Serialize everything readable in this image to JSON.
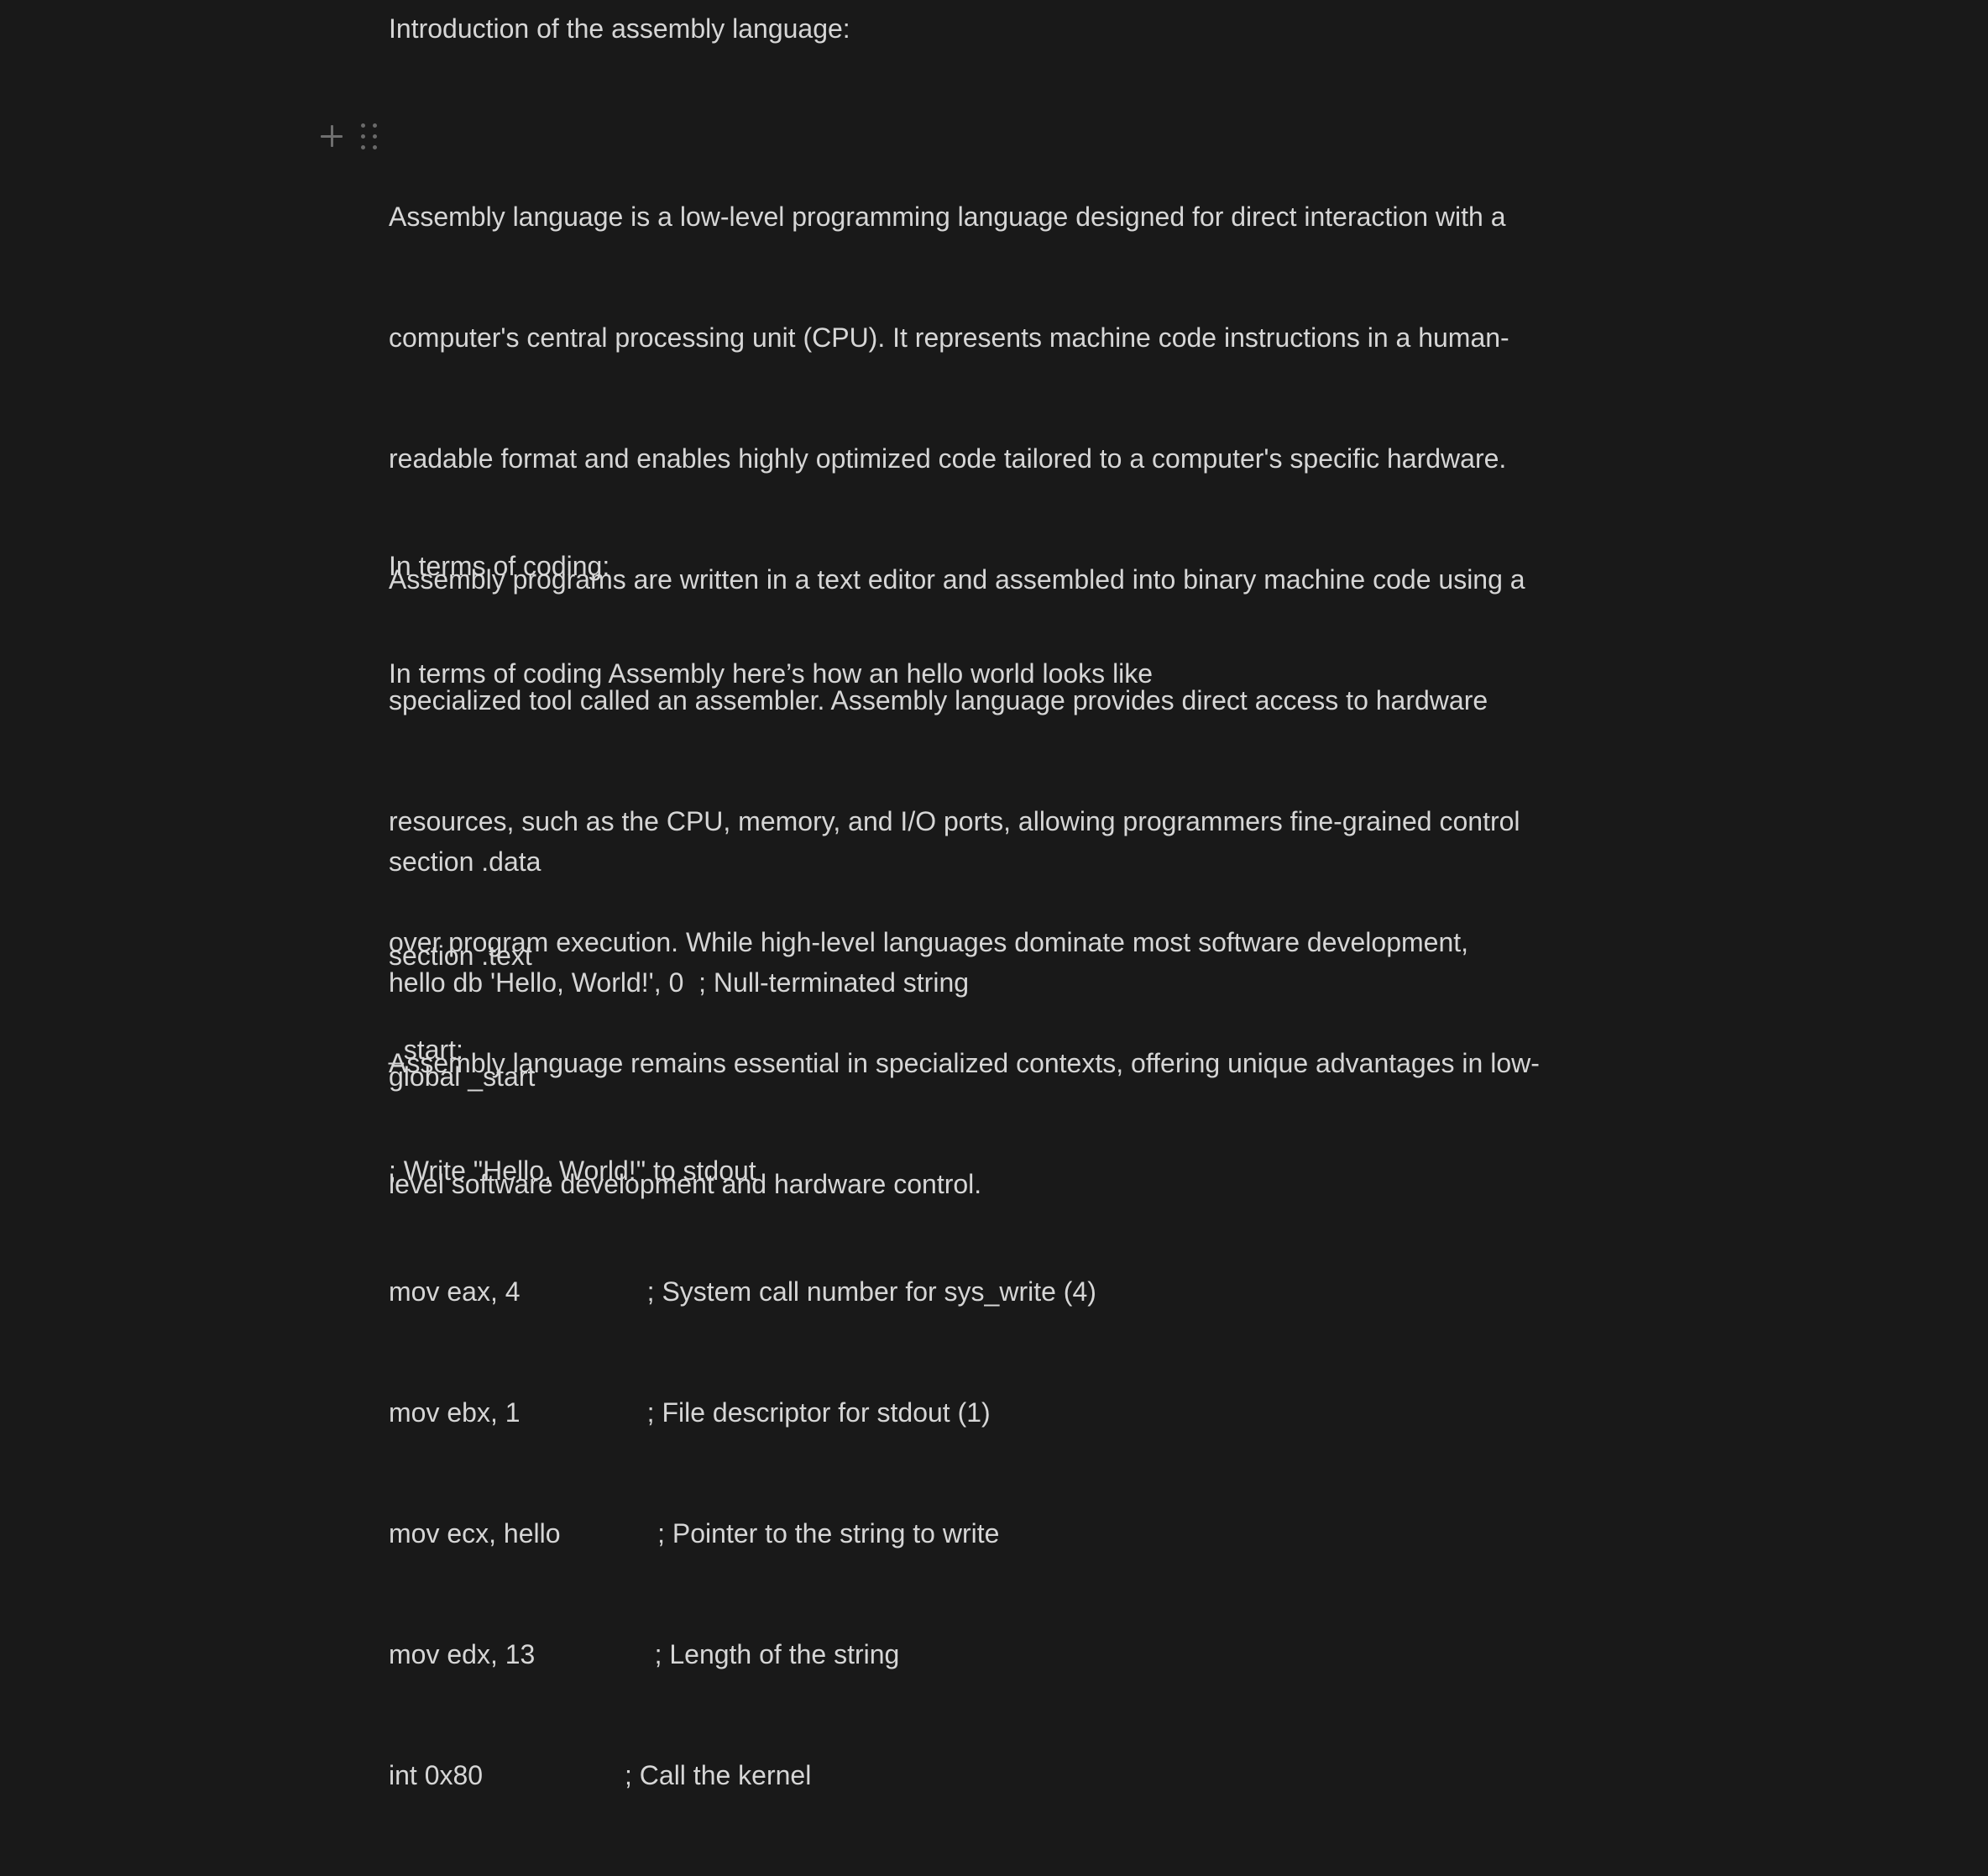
{
  "blocks": {
    "heading_intro": "Introduction of the assembly language:",
    "paragraph_intro": [
      "Assembly language is a low-level programming language designed for direct interaction with a",
      "computer's central processing unit (CPU). It represents machine code instructions in a human-",
      "readable format and enables highly optimized code tailored to a computer's specific hardware.",
      "Assembly programs are written in a text editor and assembled into binary machine code using a",
      "specialized tool called an assembler. Assembly language provides direct access to hardware",
      "resources, such as the CPU, memory, and I/O ports, allowing programmers fine-grained control",
      "over program execution. While high-level languages dominate most software development,",
      "Assembly language remains essential in specialized contexts, offering unique advantages in low-",
      "level software development and hardware control."
    ],
    "heading_coding": "In terms of coding:",
    "coding_intro": "In terms of coding Assembly here’s how an hello world looks like",
    "code_data": [
      "section .data",
      "hello db 'Hello, World!', 0  ; Null-terminated string"
    ],
    "code_text": [
      "section .text",
      "global _start"
    ],
    "code_start": [
      "_start:",
      "; Write \"Hello, World!\" to stdout",
      "mov eax, 4                 ; System call number for sys_write (4)",
      "mov ebx, 1                 ; File descriptor for stdout (1)",
      "mov ecx, hello             ; Pointer to the string to write",
      "mov edx, 13                ; Length of the string",
      "int 0x80                   ; Call the kernel"
    ]
  },
  "controls": {
    "add_block_icon": "plus-icon",
    "drag_handle_icon": "drag-handle-icon"
  }
}
